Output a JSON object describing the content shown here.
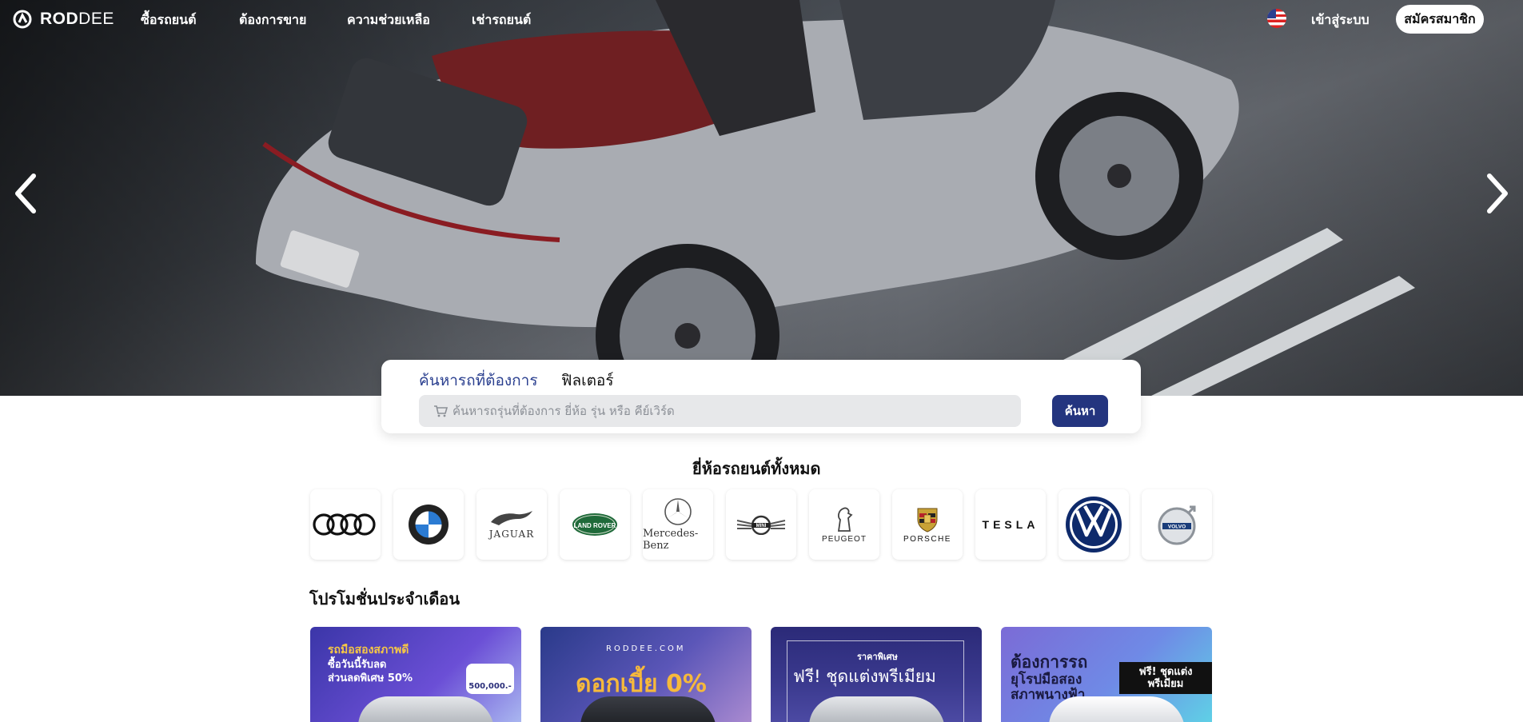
{
  "brand": {
    "name_bold": "ROD",
    "name_light": "DEE"
  },
  "nav": {
    "items": [
      {
        "label": "ซื้อรถยนต์"
      },
      {
        "label": "ต้องการขาย"
      },
      {
        "label": "ความช่วยเหลือ"
      },
      {
        "label": "เช่ารถยนต์"
      }
    ],
    "language_icon": "us-flag-icon",
    "login_label": "เข้าสู่ระบบ",
    "signup_label": "สมัครสมาชิก"
  },
  "hero": {
    "prev_icon": "chevron-left-icon",
    "next_icon": "chevron-right-icon"
  },
  "search": {
    "tab_search": "ค้นหารถที่ต้องการ",
    "tab_filter": "ฟิลเตอร์",
    "placeholder": "ค้นหารถรุ่นที่ต้องการ ยี่ห้อ รุ่น หรือ คีย์เวิร์ด",
    "icon": "cart-icon",
    "button_label": "ค้นหา"
  },
  "brands": {
    "title": "ยี่ห้อรถยนต์ทั้งหมด",
    "items": [
      {
        "icon": "audi-logo"
      },
      {
        "icon": "bmw-logo"
      },
      {
        "icon": "jaguar-logo",
        "text": "JAGUAR"
      },
      {
        "icon": "land-rover-logo",
        "text": "LAND ROVER"
      },
      {
        "icon": "mercedes-benz-logo",
        "text": "Mercedes-Benz"
      },
      {
        "icon": "mini-logo",
        "text": "MINI"
      },
      {
        "icon": "peugeot-logo",
        "text": "PEUGEOT"
      },
      {
        "icon": "porsche-logo",
        "text": "PORSCHE"
      },
      {
        "icon": "tesla-logo",
        "text": "TESLA"
      },
      {
        "icon": "volkswagen-logo"
      },
      {
        "icon": "volvo-logo",
        "text": "VOLVO"
      }
    ]
  },
  "promotions": {
    "title": "โปรโมชั่นประจำเดือน",
    "items": [
      {
        "line1": "รถมือสองสภาพดี",
        "line2": "ซื้อวันนี้รับลด",
        "line3": "ส่วนลดพิเศษ 50%",
        "price": "500,000.-"
      },
      {
        "site": "RODDEE.COM",
        "headline": "ดอกเบี้ย 0%"
      },
      {
        "tag": "ราคาพิเศษ",
        "headline": "ฟรี! ชุดแต่งพรีเมียม"
      },
      {
        "line1": "ต้องการรถ",
        "line2": "ยุโรปมือสอง",
        "line3": "สภาพนางฟ้า",
        "badge": "ฟรี! ชุดแต่ง พรีเมียม"
      }
    ]
  },
  "colors": {
    "primary": "#24357f",
    "accent_tab": "#2a3f8f",
    "input_bg": "#e7e8ea"
  }
}
